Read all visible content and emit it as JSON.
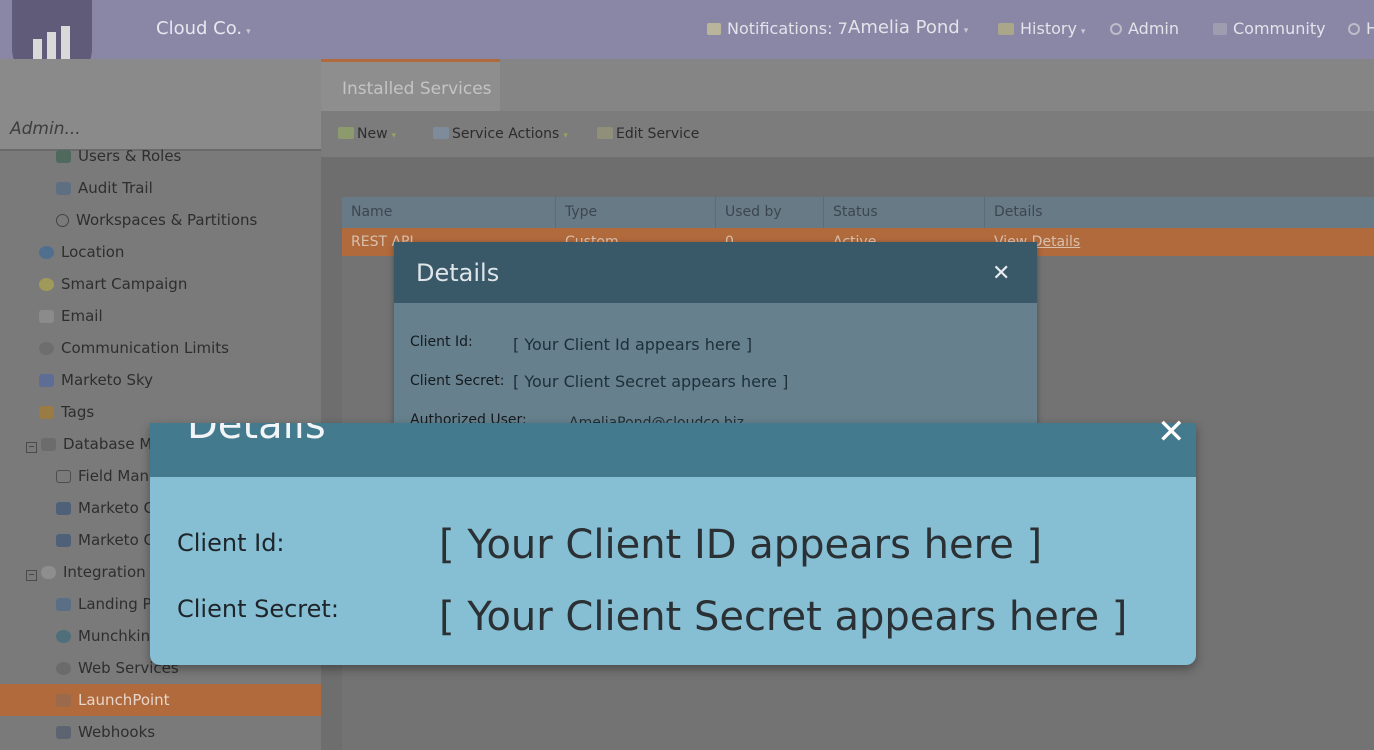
{
  "header": {
    "brand": "Cloud Co.",
    "notifications": "Notifications: 7",
    "user": "Amelia Pond",
    "history": "History",
    "admin": "Admin",
    "community": "Community",
    "help": "H"
  },
  "sidebar": {
    "search_text": "Admin...",
    "items": [
      {
        "label": "Users & Roles",
        "icon": "users-icon"
      },
      {
        "label": "Audit Trail",
        "icon": "audit-icon"
      },
      {
        "label": "Workspaces & Partitions",
        "icon": "globe-icon"
      },
      {
        "label": "Location",
        "icon": "location-icon"
      },
      {
        "label": "Smart Campaign",
        "icon": "lightbulb-icon"
      },
      {
        "label": "Email",
        "icon": "email-icon"
      },
      {
        "label": "Communication Limits",
        "icon": "limits-icon"
      },
      {
        "label": "Marketo Sky",
        "icon": "bird-icon"
      },
      {
        "label": "Tags",
        "icon": "tag-icon"
      },
      {
        "label": "Database Ma",
        "icon": "database-icon"
      },
      {
        "label": "Field Mana",
        "icon": "field-icon"
      },
      {
        "label": "Marketo C",
        "icon": "marketo-icon"
      },
      {
        "label": "Marketo C",
        "icon": "marketo-icon"
      },
      {
        "label": "Integration",
        "icon": "cloud-icon"
      },
      {
        "label": "Landing Pa",
        "icon": "landing-page-icon"
      },
      {
        "label": "Munchkin",
        "icon": "munchkin-icon"
      },
      {
        "label": "Web Services",
        "icon": "web-services-icon"
      },
      {
        "label": "LaunchPoint",
        "icon": "rocket-icon"
      },
      {
        "label": "Webhooks",
        "icon": "webhook-icon"
      }
    ]
  },
  "main": {
    "tab": "Installed Services",
    "toolbar": {
      "new": "New",
      "service_actions": "Service Actions",
      "edit_service": "Edit Service"
    },
    "grid": {
      "columns": [
        "Name",
        "Type",
        "Used by",
        "Status",
        "Details"
      ],
      "row": [
        "REST API",
        "Custom",
        "0",
        "Active",
        "View Details"
      ]
    }
  },
  "details_dialog": {
    "title": "Details",
    "client_id_label": "Client Id:",
    "client_id_value": "[ Your Client Id appears here ]",
    "client_secret_label": "Client Secret:",
    "client_secret_value": "[ Your Client Secret appears here ]",
    "authorized_user_label": "Authorized User:",
    "authorized_user_value": "AmeliaPond@cloudco.biz"
  },
  "zoom_callout": {
    "title": "Details",
    "client_id_label": "Client Id:",
    "client_id_value": "[ Your Client ID appears here ]",
    "client_secret_label": "Client Secret:",
    "client_secret_value": "[ Your Client Secret appears here ]"
  }
}
